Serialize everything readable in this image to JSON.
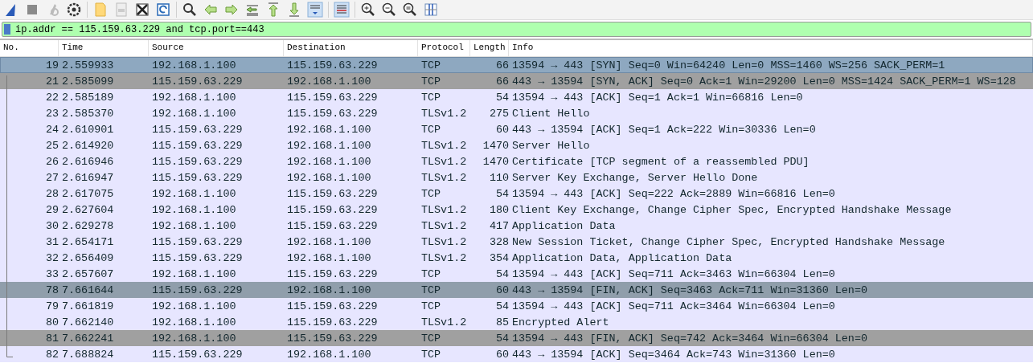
{
  "filter": {
    "value": "ip.addr == 115.159.63.229 and tcp.port==443"
  },
  "table": {
    "columns": [
      "No.",
      "Time",
      "Source",
      "Destination",
      "Protocol",
      "Length",
      "Info"
    ],
    "rows": [
      {
        "no": "19",
        "time": "2.559933",
        "source": "192.168.1.100",
        "destination": "115.159.63.229",
        "protocol": "TCP",
        "length": "66",
        "info": "13594 → 443 [SYN] Seq=0 Win=64240 Len=0 MSS=1460 WS=256 SACK_PERM=1",
        "selected": true,
        "color": "#8ea8c0"
      },
      {
        "no": "21",
        "time": "2.585099",
        "source": "115.159.63.229",
        "destination": "192.168.1.100",
        "protocol": "TCP",
        "length": "66",
        "info": "443 → 13594 [SYN, ACK] Seq=0 Ack=1 Win=29200 Len=0 MSS=1424 SACK_PERM=1 WS=128",
        "selected": false,
        "color": "#a0a0a0"
      },
      {
        "no": "22",
        "time": "2.585189",
        "source": "192.168.1.100",
        "destination": "115.159.63.229",
        "protocol": "TCP",
        "length": "54",
        "info": "13594 → 443 [ACK] Seq=1 Ack=1 Win=66816 Len=0",
        "selected": false,
        "color": "#e7e6ff"
      },
      {
        "no": "23",
        "time": "2.585370",
        "source": "192.168.1.100",
        "destination": "115.159.63.229",
        "protocol": "TLSv1.2",
        "length": "275",
        "info": "Client Hello",
        "selected": false,
        "color": "#e7e6ff"
      },
      {
        "no": "24",
        "time": "2.610901",
        "source": "115.159.63.229",
        "destination": "192.168.1.100",
        "protocol": "TCP",
        "length": "60",
        "info": "443 → 13594 [ACK] Seq=1 Ack=222 Win=30336 Len=0",
        "selected": false,
        "color": "#e7e6ff"
      },
      {
        "no": "25",
        "time": "2.614920",
        "source": "115.159.63.229",
        "destination": "192.168.1.100",
        "protocol": "TLSv1.2",
        "length": "1470",
        "info": "Server Hello",
        "selected": false,
        "color": "#e7e6ff"
      },
      {
        "no": "26",
        "time": "2.616946",
        "source": "115.159.63.229",
        "destination": "192.168.1.100",
        "protocol": "TLSv1.2",
        "length": "1470",
        "info": "Certificate [TCP segment of a reassembled PDU]",
        "selected": false,
        "color": "#e7e6ff"
      },
      {
        "no": "27",
        "time": "2.616947",
        "source": "115.159.63.229",
        "destination": "192.168.1.100",
        "protocol": "TLSv1.2",
        "length": "110",
        "info": "Server Key Exchange, Server Hello Done",
        "selected": false,
        "color": "#e7e6ff"
      },
      {
        "no": "28",
        "time": "2.617075",
        "source": "192.168.1.100",
        "destination": "115.159.63.229",
        "protocol": "TCP",
        "length": "54",
        "info": "13594 → 443 [ACK] Seq=222 Ack=2889 Win=66816 Len=0",
        "selected": false,
        "color": "#e7e6ff"
      },
      {
        "no": "29",
        "time": "2.627604",
        "source": "192.168.1.100",
        "destination": "115.159.63.229",
        "protocol": "TLSv1.2",
        "length": "180",
        "info": "Client Key Exchange, Change Cipher Spec, Encrypted Handshake Message",
        "selected": false,
        "color": "#e7e6ff"
      },
      {
        "no": "30",
        "time": "2.629278",
        "source": "192.168.1.100",
        "destination": "115.159.63.229",
        "protocol": "TLSv1.2",
        "length": "417",
        "info": "Application Data",
        "selected": false,
        "color": "#e7e6ff"
      },
      {
        "no": "31",
        "time": "2.654171",
        "source": "115.159.63.229",
        "destination": "192.168.1.100",
        "protocol": "TLSv1.2",
        "length": "328",
        "info": "New Session Ticket, Change Cipher Spec, Encrypted Handshake Message",
        "selected": false,
        "color": "#e7e6ff"
      },
      {
        "no": "32",
        "time": "2.656409",
        "source": "115.159.63.229",
        "destination": "192.168.1.100",
        "protocol": "TLSv1.2",
        "length": "354",
        "info": "Application Data, Application Data",
        "selected": false,
        "color": "#e7e6ff"
      },
      {
        "no": "33",
        "time": "2.657607",
        "source": "192.168.1.100",
        "destination": "115.159.63.229",
        "protocol": "TCP",
        "length": "54",
        "info": "13594 → 443 [ACK] Seq=711 Ack=3463 Win=66304 Len=0",
        "selected": false,
        "color": "#e7e6ff"
      },
      {
        "no": "78",
        "time": "7.661644",
        "source": "115.159.63.229",
        "destination": "192.168.1.100",
        "protocol": "TCP",
        "length": "60",
        "info": "443 → 13594 [FIN, ACK] Seq=3463 Ack=711 Win=31360 Len=0",
        "selected": false,
        "color": "#909eab"
      },
      {
        "no": "79",
        "time": "7.661819",
        "source": "192.168.1.100",
        "destination": "115.159.63.229",
        "protocol": "TCP",
        "length": "54",
        "info": "13594 → 443 [ACK] Seq=711 Ack=3464 Win=66304 Len=0",
        "selected": false,
        "color": "#e7e6ff"
      },
      {
        "no": "80",
        "time": "7.662140",
        "source": "192.168.1.100",
        "destination": "115.159.63.229",
        "protocol": "TLSv1.2",
        "length": "85",
        "info": "Encrypted Alert",
        "selected": false,
        "color": "#e7e6ff"
      },
      {
        "no": "81",
        "time": "7.662241",
        "source": "192.168.1.100",
        "destination": "115.159.63.229",
        "protocol": "TCP",
        "length": "54",
        "info": "13594 → 443 [FIN, ACK] Seq=742 Ack=3464 Win=66304 Len=0",
        "selected": false,
        "color": "#a0a0a0"
      },
      {
        "no": "82",
        "time": "7.688824",
        "source": "115.159.63.229",
        "destination": "192.168.1.100",
        "protocol": "TCP",
        "length": "60",
        "info": "443 → 13594 [ACK] Seq=3464 Ack=743 Win=31360 Len=0",
        "selected": false,
        "color": "#e7e6ff"
      }
    ]
  }
}
